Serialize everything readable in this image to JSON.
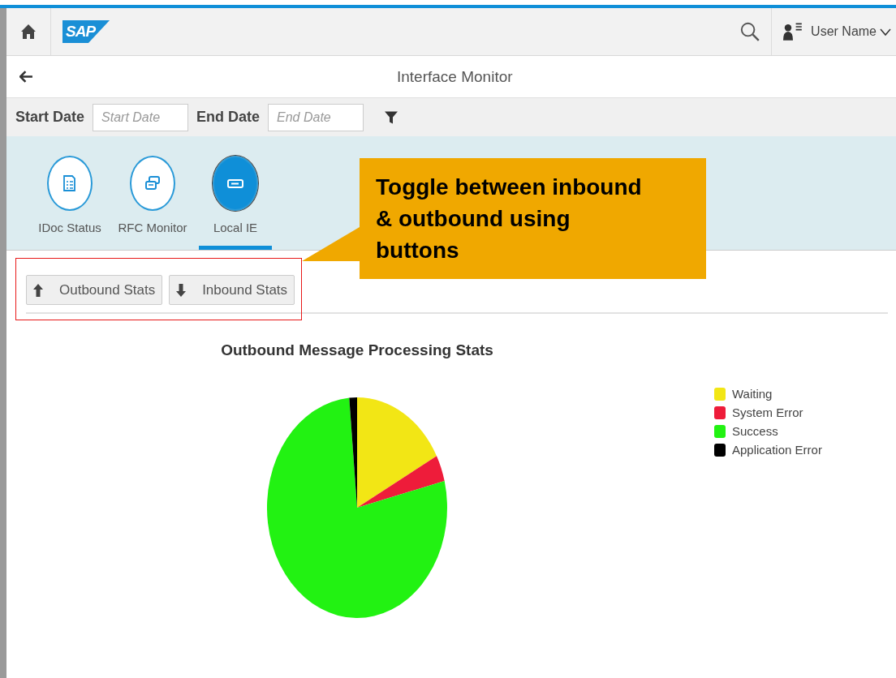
{
  "header": {
    "logo": "SAP",
    "user_name": "User Name"
  },
  "page_title": "Interface Monitor",
  "filters": [
    {
      "label": "Start Date",
      "placeholder": "Start Date"
    },
    {
      "label": "End Date",
      "placeholder": "End Date"
    }
  ],
  "tabs": [
    {
      "label": "IDoc Status",
      "selected": false
    },
    {
      "label": "RFC Monitor",
      "selected": false
    },
    {
      "label": "Local IE",
      "selected": true
    }
  ],
  "buttons": [
    {
      "label": "Outbound Stats",
      "kind": "up"
    },
    {
      "label": "Inbound Stats",
      "kind": "down"
    }
  ],
  "chart": {
    "title": "Outbound Message Processing Stats",
    "legend": [
      {
        "label": "Waiting",
        "color": "#f2e615"
      },
      {
        "label": "System Error",
        "color": "#ee1c3a"
      },
      {
        "label": "Success",
        "color": "#22f212"
      },
      {
        "label": "Application Error",
        "color": "#000000"
      }
    ]
  },
  "callout": {
    "text": "Toggle between inbound & outbound using buttons"
  }
}
